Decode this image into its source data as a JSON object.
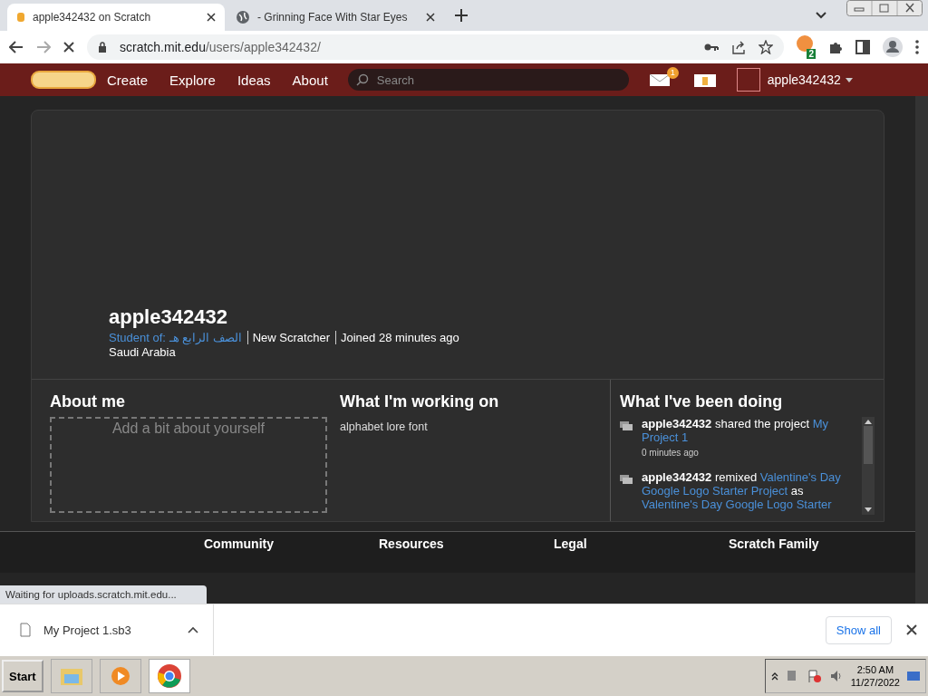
{
  "browser": {
    "tabs": [
      {
        "title": "apple342432 on Scratch",
        "selected": true,
        "kind": "scratch"
      },
      {
        "title": " - Grinning Face With Star Eyes",
        "selected": false,
        "kind": "globe"
      }
    ],
    "url_host": "scratch.mit.edu",
    "url_path": "/users/apple342432/",
    "extension_badge": "2"
  },
  "nav": {
    "items": [
      "Create",
      "Explore",
      "Ideas",
      "About"
    ],
    "search_placeholder": "Search",
    "messages_count": "1",
    "username": "apple342432"
  },
  "profile": {
    "username": "apple342432",
    "student_of_label": "Student of:",
    "student_of_class": "الصف الرابع هـ",
    "rank": "New Scratcher",
    "joined": "Joined 28 minutes ago",
    "country": "Saudi Arabia"
  },
  "about_me": {
    "heading": "About me",
    "placeholder": "Add a bit about yourself"
  },
  "working_on": {
    "heading": "What I'm working on",
    "value": "alphabet lore font"
  },
  "activity": {
    "heading": "What I've been doing",
    "items": [
      {
        "actor": "apple342432",
        "verb": "shared the project",
        "project": "My Project 1",
        "time": "0 minutes ago"
      },
      {
        "actor": "apple342432",
        "verb": "remixed",
        "project": "Valentine's Day Google Logo Starter Project",
        "connector": "as",
        "result": "Valentine's Day Google Logo Starter"
      }
    ]
  },
  "footer": {
    "headings": [
      "Community",
      "Resources",
      "Legal",
      "Scratch Family"
    ]
  },
  "status_bubble": "Waiting for uploads.scratch.mit.edu...",
  "download": {
    "file": "My Project 1.sb3",
    "show_all": "Show all"
  },
  "taskbar": {
    "start": "Start",
    "time": "2:50 AM",
    "date": "11/27/2022"
  }
}
